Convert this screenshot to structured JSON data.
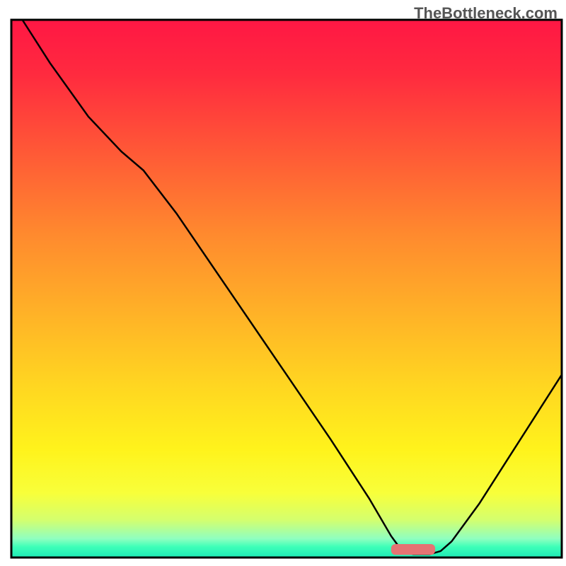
{
  "watermark": "TheBottleneck.com",
  "chart_data": {
    "type": "line",
    "title": "",
    "xlabel": "",
    "ylabel": "",
    "xlim": [
      0,
      100
    ],
    "ylim": [
      0,
      100
    ],
    "background_gradient": {
      "stops": [
        {
          "offset": 0,
          "color": "#ff1744"
        },
        {
          "offset": 10,
          "color": "#ff2a3f"
        },
        {
          "offset": 25,
          "color": "#ff5a36"
        },
        {
          "offset": 40,
          "color": "#ff8a2e"
        },
        {
          "offset": 55,
          "color": "#ffb327"
        },
        {
          "offset": 68,
          "color": "#ffd621"
        },
        {
          "offset": 80,
          "color": "#fff31c"
        },
        {
          "offset": 88,
          "color": "#f8ff3a"
        },
        {
          "offset": 93,
          "color": "#d4ff6e"
        },
        {
          "offset": 96.5,
          "color": "#8fffc0"
        },
        {
          "offset": 98,
          "color": "#3effb8"
        },
        {
          "offset": 100,
          "color": "#1de9b6"
        }
      ]
    },
    "marker": {
      "x": 73,
      "y": 1.5,
      "width": 8,
      "height": 2,
      "color": "#e57373"
    },
    "curve": [
      {
        "x": 2,
        "y": 100
      },
      {
        "x": 7,
        "y": 92
      },
      {
        "x": 14,
        "y": 82
      },
      {
        "x": 20,
        "y": 75.5
      },
      {
        "x": 24,
        "y": 72
      },
      {
        "x": 30,
        "y": 64
      },
      {
        "x": 40,
        "y": 49
      },
      {
        "x": 50,
        "y": 34
      },
      {
        "x": 58,
        "y": 22
      },
      {
        "x": 65,
        "y": 11
      },
      {
        "x": 69,
        "y": 4
      },
      {
        "x": 71,
        "y": 1.2
      },
      {
        "x": 73,
        "y": 0.6
      },
      {
        "x": 76,
        "y": 0.6
      },
      {
        "x": 78,
        "y": 1.2
      },
      {
        "x": 80,
        "y": 3
      },
      {
        "x": 85,
        "y": 10
      },
      {
        "x": 90,
        "y": 18
      },
      {
        "x": 95,
        "y": 26
      },
      {
        "x": 100,
        "y": 34
      }
    ]
  }
}
